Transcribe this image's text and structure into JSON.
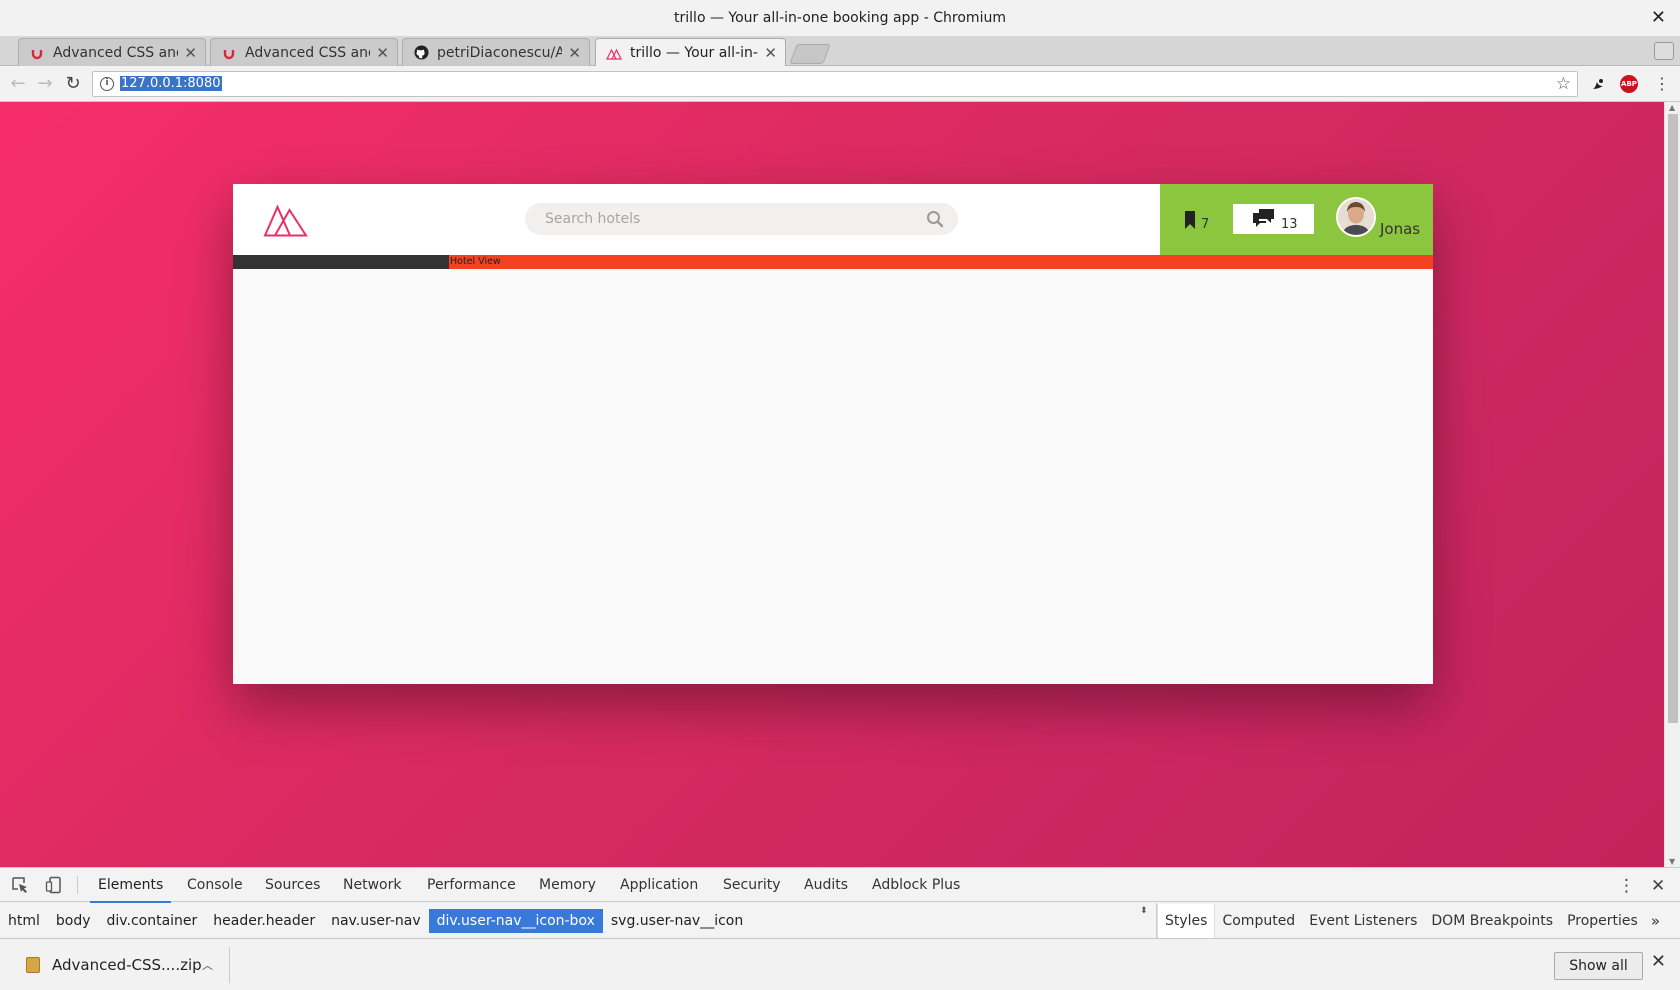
{
  "window": {
    "title": "trillo — Your all-in-one booking app - Chromium"
  },
  "tabs": [
    {
      "title": "Advanced CSS and S",
      "favicon": "udemy-icon",
      "active": false
    },
    {
      "title": "Advanced CSS and S",
      "favicon": "udemy-icon",
      "active": false
    },
    {
      "title": "petriDiaconescu/Adv",
      "favicon": "github-icon",
      "active": false
    },
    {
      "title": "trillo — Your all-in-o",
      "favicon": "trillo-icon",
      "active": true
    }
  ],
  "toolbar": {
    "url": "127.0.0.1:8080"
  },
  "page": {
    "search": {
      "placeholder": "Search hotels"
    },
    "user_nav": {
      "bookmarks_count": "7",
      "chat_count": "13",
      "user_name": "Jonas"
    },
    "content": {
      "label": "Hotel View"
    },
    "colors": {
      "background_from": "#f72d6b",
      "background_to": "#c3235a",
      "user_nav": "#8cc63e",
      "content_bar": "#f4411f",
      "sidebar_bar": "#333333",
      "logo": "#eb2f64"
    }
  },
  "devtools": {
    "tabs": [
      "Elements",
      "Console",
      "Sources",
      "Network",
      "Performance",
      "Memory",
      "Application",
      "Security",
      "Audits",
      "Adblock Plus"
    ],
    "active_tab": "Elements",
    "breadcrumbs": [
      "html",
      "body",
      "div.container",
      "header.header",
      "nav.user-nav",
      "div.user-nav__icon-box",
      "svg.user-nav__icon"
    ],
    "selected_breadcrumb": "div.user-nav__icon-box",
    "side_tabs": [
      "Styles",
      "Computed",
      "Event Listeners",
      "DOM Breakpoints",
      "Properties"
    ],
    "active_side_tab": "Styles"
  },
  "downloads": {
    "file_name": "Advanced-CSS....zip",
    "show_all_label": "Show all"
  }
}
